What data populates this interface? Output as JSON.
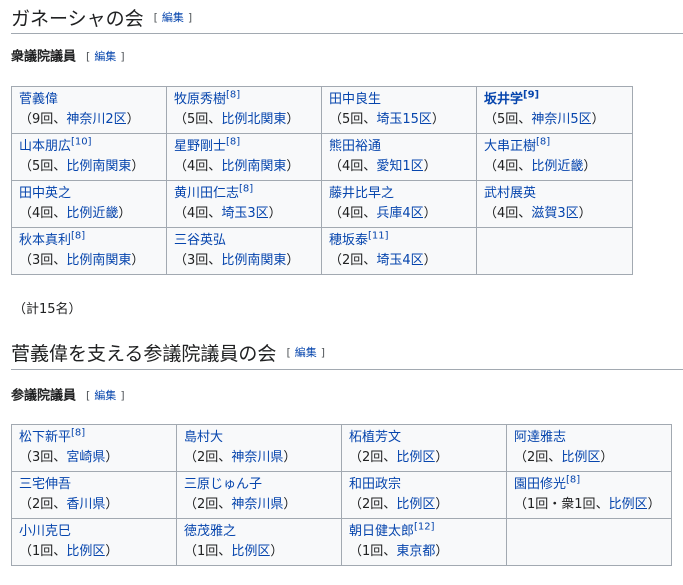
{
  "edit_label": "編集",
  "section1": {
    "title": "ガネーシャの会",
    "sub": "衆議院議員",
    "members": [
      {
        "name": "菅義偉",
        "bold": false,
        "ref": "",
        "count": "9回",
        "district": "神奈川2区"
      },
      {
        "name": "牧原秀樹",
        "bold": false,
        "ref": "[8]",
        "count": "5回",
        "district": "比例北関東"
      },
      {
        "name": "田中良生",
        "bold": false,
        "ref": "",
        "count": "5回",
        "district": "埼玉15区"
      },
      {
        "name": "坂井学",
        "bold": true,
        "ref": "[9]",
        "count": "5回",
        "district": "神奈川5区"
      },
      {
        "name": "山本朋広",
        "bold": false,
        "ref": "[10]",
        "count": "5回",
        "district": "比例南関東"
      },
      {
        "name": "星野剛士",
        "bold": false,
        "ref": "[8]",
        "count": "4回",
        "district": "比例南関東"
      },
      {
        "name": "熊田裕通",
        "bold": false,
        "ref": "",
        "count": "4回",
        "district": "愛知1区"
      },
      {
        "name": "大串正樹",
        "bold": false,
        "ref": "[8]",
        "count": "4回",
        "district": "比例近畿"
      },
      {
        "name": "田中英之",
        "bold": false,
        "ref": "",
        "count": "4回",
        "district": "比例近畿"
      },
      {
        "name": "黄川田仁志",
        "bold": false,
        "ref": "[8]",
        "count": "4回",
        "district": "埼玉3区"
      },
      {
        "name": "藤井比早之",
        "bold": false,
        "ref": "",
        "count": "4回",
        "district": "兵庫4区"
      },
      {
        "name": "武村展英",
        "bold": false,
        "ref": "",
        "count": "4回",
        "district": "滋賀3区"
      },
      {
        "name": "秋本真利",
        "bold": false,
        "ref": "[8]",
        "count": "3回",
        "district": "比例南関東"
      },
      {
        "name": "三谷英弘",
        "bold": false,
        "ref": "",
        "count": "3回",
        "district": "比例南関東"
      },
      {
        "name": "穂坂泰",
        "bold": false,
        "ref": "[11]",
        "count": "2回",
        "district": "埼玉4区"
      }
    ],
    "total": "（計15名）"
  },
  "section2": {
    "title": "菅義偉を支える参議院議員の会",
    "sub": "参議院議員",
    "members": [
      {
        "name": "松下新平",
        "bold": false,
        "ref": "[8]",
        "count": "3回",
        "district": "宮崎県"
      },
      {
        "name": "島村大",
        "bold": false,
        "ref": "",
        "count": "2回",
        "district": "神奈川県"
      },
      {
        "name": "柘植芳文",
        "bold": false,
        "ref": "",
        "count": "2回",
        "district": "比例区"
      },
      {
        "name": "阿達雅志",
        "bold": false,
        "ref": "",
        "count": "2回",
        "district": "比例区"
      },
      {
        "name": "三宅伸吾",
        "bold": false,
        "ref": "",
        "count": "2回",
        "district": "香川県"
      },
      {
        "name": "三原じゅん子",
        "bold": false,
        "ref": "",
        "count": "2回",
        "district": "神奈川県"
      },
      {
        "name": "和田政宗",
        "bold": false,
        "ref": "",
        "count": "2回",
        "district": "比例区"
      },
      {
        "name": "園田修光",
        "bold": false,
        "ref": "[8]",
        "count": "1回・衆1回",
        "district": "比例区"
      },
      {
        "name": "小川克巳",
        "bold": false,
        "ref": "",
        "count": "1回",
        "district": "比例区"
      },
      {
        "name": "徳茂雅之",
        "bold": false,
        "ref": "",
        "count": "1回",
        "district": "比例区"
      },
      {
        "name": "朝日健太郎",
        "bold": false,
        "ref": "[12]",
        "count": "1回",
        "district": "東京都"
      }
    ]
  }
}
